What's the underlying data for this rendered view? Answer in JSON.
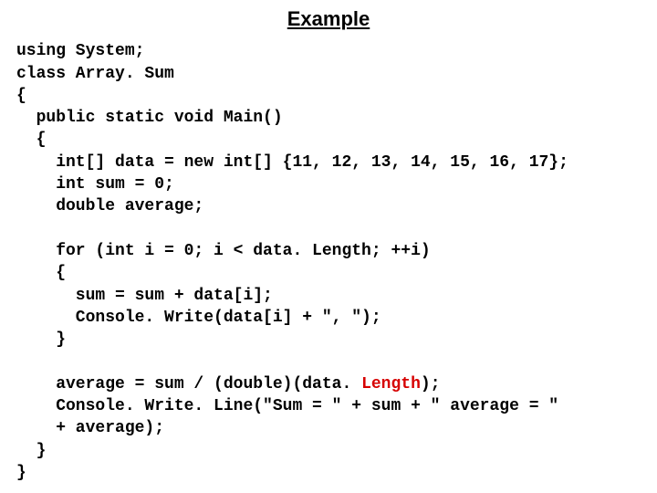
{
  "title": "Example",
  "code": {
    "l1": "using System;",
    "l2": "class Array. Sum",
    "l3": "{",
    "l4": "  public static void Main()",
    "l5": "  {",
    "l6": "    int[] data = new int[] {11, 12, 13, 14, 15, 16, 17};",
    "l7": "    int sum = 0;",
    "l8": "    double average;",
    "blank1": "",
    "l9": "    for (int i = 0; i < data. Length; ++i)",
    "l10": "    {",
    "l11": "      sum = sum + data[i];",
    "l12": "      Console. Write(data[i] + \", \");",
    "l13": "    }",
    "blank2": "",
    "l14a": "    average = sum / (double)(data. ",
    "l14b": "Length",
    "l14c": ");",
    "l15": "    Console. Write. Line(\"Sum = \" + sum + \" average = \"",
    "l16": "    + average);",
    "l17": "  }",
    "l18": "}"
  }
}
